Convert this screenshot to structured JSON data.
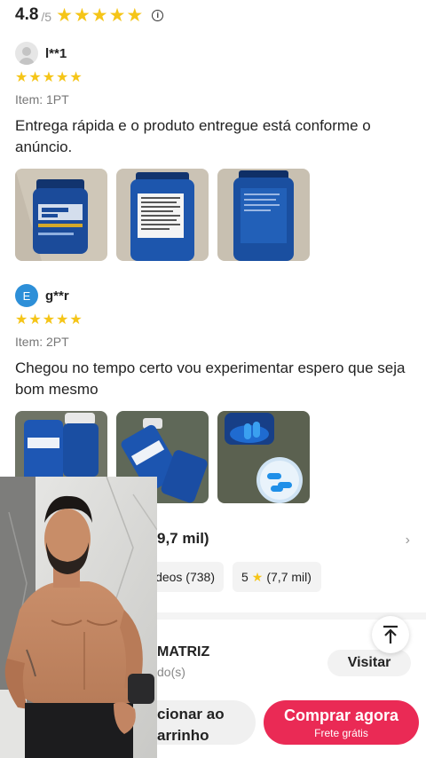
{
  "rating": {
    "score": "4.8",
    "max": "/5",
    "stars": 5,
    "info_icon": "info-icon"
  },
  "reviews": [
    {
      "avatar": {
        "type": "default-user-icon",
        "letter": ""
      },
      "name": "l**1",
      "stars": 5,
      "item": "Item: 1PT",
      "text": "Entrega rápida e o produto entregue está conforme o anúncio.",
      "photos": [
        "photo-1",
        "photo-2",
        "photo-3"
      ]
    },
    {
      "avatar": {
        "type": "letter",
        "letter": "E"
      },
      "name": "g**r",
      "stars": 5,
      "item": "Item: 2PT",
      "text": "Chegou no tempo certo  vou experimentar espero que seja bom mesmo",
      "photos": [
        "photo-1",
        "photo-2",
        "photo-3"
      ]
    }
  ],
  "summary": {
    "title": "9,7 mil)",
    "chips": [
      {
        "label": "deos (738)"
      },
      {
        "label_prefix": "5",
        "label_suffix": "(7,7 mil)"
      }
    ]
  },
  "shop": {
    "name": "MATRIZ",
    "sub": "do(s)",
    "visit_label": "Visitar"
  },
  "bottom": {
    "cart_label": "cionar ao arrinho",
    "buy_label": "Comprar agora",
    "buy_sub": "Frete grátis"
  },
  "colors": {
    "star": "#f5c518",
    "buy": "#ea2a55",
    "avatar_blue": "#2d8fd8"
  }
}
